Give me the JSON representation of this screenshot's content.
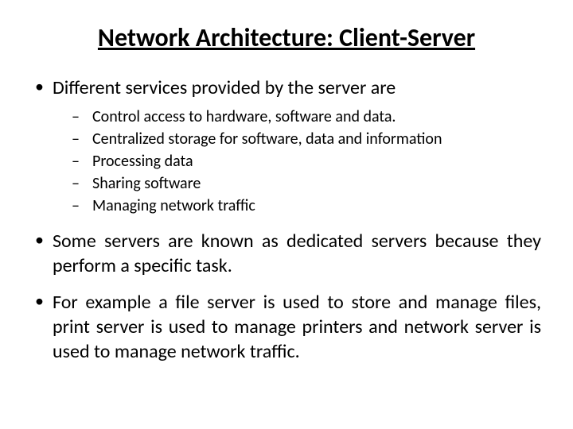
{
  "title": "Network Architecture: Client-Server",
  "bullets": {
    "b1": "Different services provided by the server are",
    "subs": {
      "s1": "Control access to hardware, software and data.",
      "s2": "Centralized storage for software, data and information",
      "s3": "Processing data",
      "s4": "Sharing software",
      "s5": "Managing network traffic"
    },
    "b2": "Some servers are known as dedicated servers because they perform a specific task.",
    "b3": "For example a file server is used to store and manage files, print server is used to manage printers and network server is used to manage network traffic."
  }
}
